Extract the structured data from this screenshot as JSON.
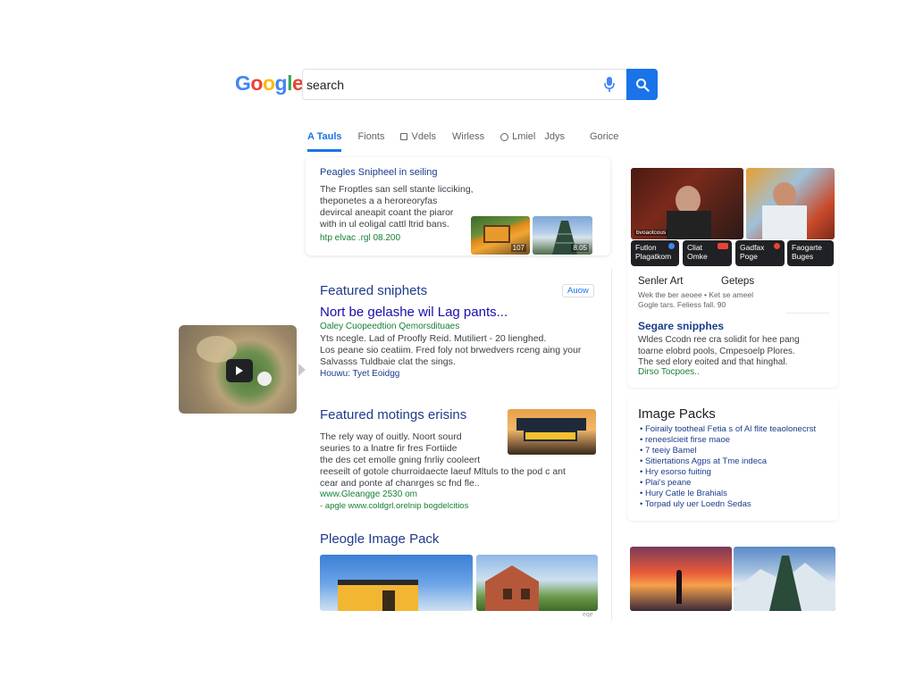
{
  "logo": {
    "text": "Google",
    "letters": [
      "G",
      "o",
      "o",
      "g",
      "l",
      "e"
    ],
    "colors": [
      "#4285F4",
      "#EA4335",
      "#FBBC05",
      "#4285F4",
      "#34A853",
      "#EA4335"
    ]
  },
  "search": {
    "value": "search",
    "placeholder": ""
  },
  "tabs": [
    "A Tauls",
    "Fionts",
    "Vdels",
    "Wirless",
    "Lmiel",
    "Jdys",
    "Gorice"
  ],
  "top_card": {
    "title": "Peagles Snipheel in seiling",
    "lines": [
      "The Froptles san sell stante licciking,",
      "theponetes a a heroreoryfas",
      "devircal aneapit coant the piaror",
      "with in ul eoligal cattl ltrid bans."
    ],
    "url": "htp elvac  .rgl 08.200",
    "img_badges": [
      "107",
      "8.05"
    ]
  },
  "video": {
    "play_icon": "play-icon"
  },
  "featured": {
    "heading": "Featured sniphets",
    "action": "Auow",
    "title": "Nort be gelashe wil Lag pants...",
    "source": "Oaley Cuopeedtion Qemorsdituaes",
    "lines": [
      "Yts ncegle. Lad of Proofly Reid. Mutiliert - 20 lienghed.",
      "Los peane sio ceatiim. Fred foly not brwedvers rceng aing your",
      "Salvasss Tuldbaie clat the sings."
    ],
    "link": "Houwu: Tyet Eoidgg"
  },
  "motings": {
    "heading": "Featured motings erisins",
    "lines": [
      "The rely way of ouitly. Noort sourd",
      "seuries to a lnatre fir fres Fortiide",
      "the des cet emolle gning fnrliy cooleert",
      "reeseilt of gotole churroidaecte laeuf Mltuls to the pod c ant",
      "cear and ponte af chanrges sc fnd fle.."
    ],
    "url": "www.Gleangge 2530 om",
    "url2": "- apgle www.coldgrl.orelnip bogdelcitios"
  },
  "image_pack_left": {
    "heading": "Pleogle Image Pack",
    "footnote": "eqe"
  },
  "right_panel": {
    "chips": [
      {
        "l1": "Futlon",
        "l2": "Plagatkom"
      },
      {
        "l1": "Cliat",
        "l2": "Omke"
      },
      {
        "l1": "Gadfax",
        "l2": "Poge"
      },
      {
        "l1": "Faogarte",
        "l2": "Buges"
      }
    ],
    "img_caption": "bvoaotcous",
    "section1": {
      "col1": "Senler Art",
      "col2": "Geteps",
      "lines": [
        "Wek the ber aeoee  • Ket se ameel",
        "Gogle tars. Feliess fall. 90"
      ]
    },
    "section2": {
      "title": "Segare snipphes",
      "lines": [
        "Wldes Ccodn ree cra solidit for hee pang",
        "toarne elobrd pools, Cmpesoelp Plores.",
        "The sed elory eoited and that hinghal."
      ],
      "link": "Dirso Tocpoes.."
    },
    "image_packs": {
      "heading": "Image Packs",
      "items": [
        "Foiraily tootheal Fetia s of Al flite teaolonecrst",
        "reneeslcieit firse maoe",
        "7 teeiy Bamel",
        "Sitiertations Agps at Tme indeca",
        "Hry esorso fuiting",
        "Plai's peane",
        "Hury Catle le Brahials",
        "Torpad uly uer Loedn Sedas"
      ]
    }
  }
}
